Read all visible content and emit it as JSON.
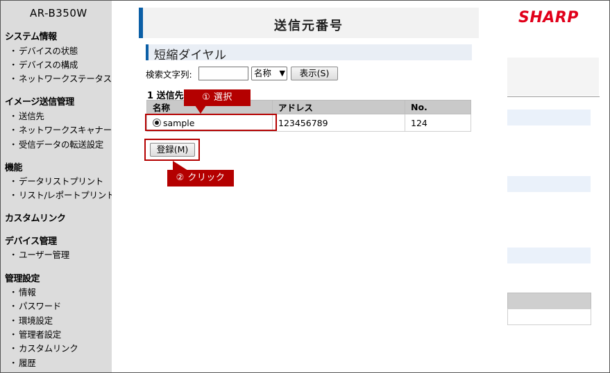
{
  "device": {
    "model": "AR-B350W"
  },
  "sidebar": {
    "sections": [
      {
        "title": "システム情報",
        "items": [
          "デバイスの状態",
          "デバイスの構成",
          "ネットワークステータス"
        ]
      },
      {
        "title": "イメージ送信管理",
        "items": [
          "送信先",
          "ネットワークスキャナー",
          "受信データの転送設定"
        ]
      },
      {
        "title": "機能",
        "items": [
          "データリストプリント",
          "リスト/レポートプリント"
        ]
      },
      {
        "title": "カスタムリンク",
        "items": []
      },
      {
        "title": "デバイス管理",
        "items": [
          "ユーザー管理"
        ]
      },
      {
        "title": "管理設定",
        "items": [
          "情報",
          "パスワード",
          "環境設定",
          "管理者設定",
          "カスタムリンク",
          "履歴"
        ]
      }
    ],
    "bullet": "・"
  },
  "page": {
    "title": "送信元番号",
    "section_title": "短縮ダイヤル"
  },
  "search": {
    "label": "検索文字列:",
    "input_value": "",
    "select_value": "名称",
    "show_button": "表示(S)"
  },
  "results": {
    "count_label": "1 送信先",
    "columns": [
      "名称",
      "アドレス",
      "No."
    ],
    "rows": [
      {
        "name": "sample",
        "address": "123456789",
        "no": "124",
        "selected": true
      }
    ]
  },
  "actions": {
    "register_button": "登録(M)"
  },
  "annotations": {
    "step1": "① 選択",
    "step2": "② クリック"
  },
  "brand": {
    "logo": "SHARP",
    "color": "#e1001a"
  },
  "colors": {
    "accent": "#0b5fa6",
    "highlight": "#b40000",
    "sidebar_bg": "#dcdcdc"
  }
}
